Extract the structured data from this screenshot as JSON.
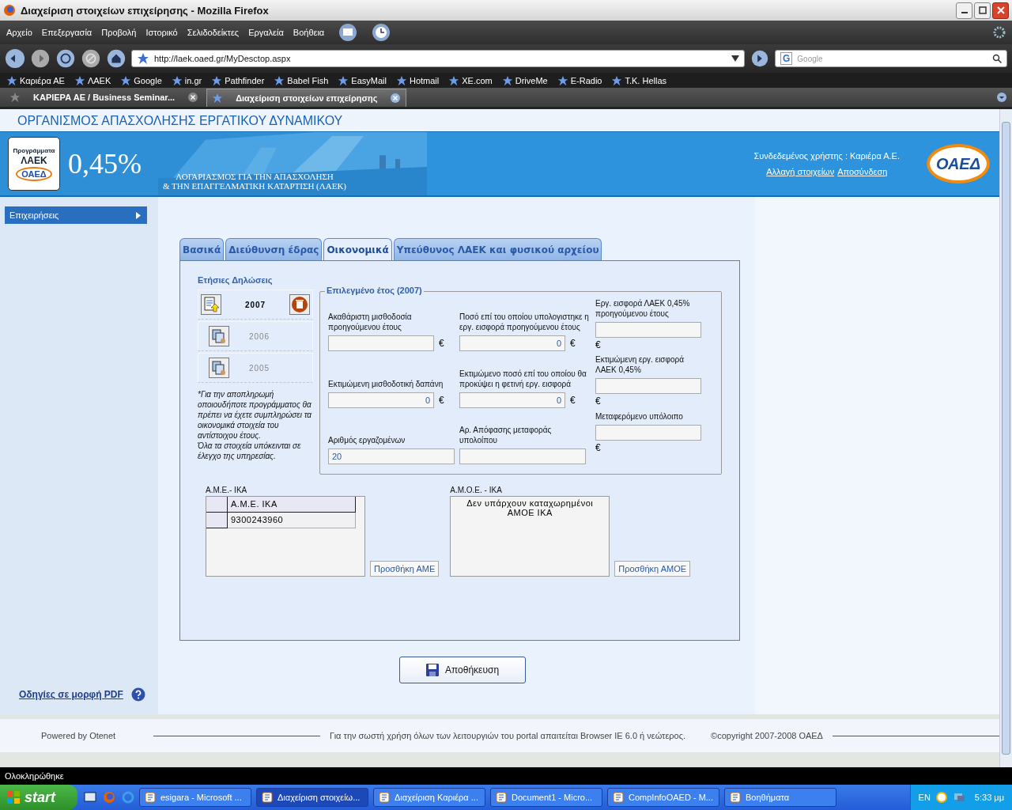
{
  "window": {
    "title": "Διαχείριση στοιχείων επιχείρησης - Mozilla Firefox"
  },
  "menu": [
    "Αρχείο",
    "Επεξεργασία",
    "Προβολή",
    "Ιστορικό",
    "Σελιδοδείκτες",
    "Εργαλεία",
    "Βοήθεια"
  ],
  "address": {
    "value": "http://laek.oaed.gr/MyDesctop.aspx"
  },
  "search": {
    "engine_mark": "G",
    "placeholder": "Google"
  },
  "bookmarks": [
    "Καριέρα ΑΕ",
    "ΛΑΕΚ",
    "Google",
    "in.gr",
    "Pathfinder",
    "Babel Fish",
    "EasyMail",
    "Hotmail",
    "XE.com",
    "DriveMe",
    "E-Radio",
    "T.K. Hellas"
  ],
  "browser_tabs": [
    {
      "label": "ΚΑΡΙΕΡΑ ΑΕ / Business Seminar...",
      "selected": false
    },
    {
      "label": "Διαχείριση στοιχείων επιχείρησης",
      "selected": true
    }
  ],
  "page": {
    "org_title": "ΟΡΓΑΝΙΣΜΟΣ ΑΠΑΣΧΟΛΗΣΗΣ ΕΡΓΑΤΙΚΟΥ ΔΥΝΑΜΙΚΟΥ",
    "banner": {
      "badge_top": "Προγράμματα",
      "badge_name": "ΛΑΕΚ",
      "badge_logo": "ΟΑΕΔ",
      "rate": "0,45%",
      "lines": [
        "ΛΟΓΑΡΙΑΣΜΟΣ ΓΙΑ ΤΗΝ ΑΠΑΣΧΟΛΗΣΗ",
        "& ΤΗΝ ΕΠΑΓΓΕΛΜΑΤΙΚΗ ΚΑΤΑΡΤΙΣΗ (ΛΑΕΚ)"
      ],
      "user": "Συνδεδεμένος χρήστης : Καριέρα Α.Ε.",
      "links": [
        "Αλλαγή στοιχείων",
        "Αποσύνδεση"
      ],
      "logo": "ΟΑΕΔ"
    },
    "sidebar": {
      "items": [
        {
          "label": "Επιχειρήσεις",
          "selected": true
        }
      ],
      "pdf_link": "Οδηγίες σε μορφή PDF"
    },
    "tabs": [
      {
        "label": "Βασικά",
        "selected": false
      },
      {
        "label": "Διεύθυνση έδρας",
        "selected": false
      },
      {
        "label": "Οικονομικά",
        "selected": true
      },
      {
        "label": "Υπεύθυνος ΛΑΕΚ και φυσικού αρχείου",
        "selected": false
      }
    ],
    "declarations": {
      "title": "Ετήσιες Δηλώσεις",
      "years": [
        {
          "year": "2007",
          "selected": true
        },
        {
          "year": "2006",
          "selected": false
        },
        {
          "year": "2005",
          "selected": false
        }
      ],
      "note": [
        "*Για την αποπληρωμή οποιουδήποτε προγράμματος θα πρέπει να έχετε συμπληρώσει τα οικονομικά στοιχεία του αντίστοιχου έτους.",
        "Όλα τα στοιχεία υπόκεινται σε έλεγχο της υπηρεσίας."
      ]
    },
    "fieldset": {
      "legend": "Επιλεγμένο έτος (2007)",
      "columns": [
        {
          "kind": "inline",
          "fields": [
            {
              "label": "Ακαθάριστη μισθοδοσία προηγούμενου έτους",
              "currency": "€"
            },
            {
              "label": "Εκτιμώμενη μισθοδοτική δαπάνη",
              "value": "0",
              "currency": "€"
            },
            {
              "label": "Αριθμός εργαζομένων",
              "value": "20"
            }
          ]
        },
        {
          "kind": "inline",
          "fields": [
            {
              "label": "Ποσό επί του οποίου υπολογιστηκε η εργ. εισφορά προηγούμενου έτους",
              "value": "0",
              "currency": "€"
            },
            {
              "label": "Εκτιμώμενο ποσό επί του οποίου θα προκύψει η φετινή εργ. εισφορά",
              "value": "0",
              "currency": "€"
            },
            {
              "label": "Αρ. Απόφασης μεταφοράς υπολοίπου"
            }
          ]
        },
        {
          "kind": "below",
          "fields": [
            {
              "label": "Εργ. εισφορά ΛΑΕΚ 0,45% προηγούμενου έτους",
              "currency": "€"
            },
            {
              "label": "Εκτιμώμενη εργ. εισφορά ΛΑΕΚ 0,45%",
              "currency": "€"
            },
            {
              "label": "Μεταφερόμενο υπόλοιπο",
              "currency": "€"
            }
          ]
        }
      ]
    },
    "ame": {
      "title": "Α.Μ.Ε.- ΙΚΑ",
      "header": "Α.Μ.Ε. ΙΚΑ",
      "rows": [
        "9300243960"
      ],
      "button": "Προσθήκη ΑΜΕ"
    },
    "amoe": {
      "title": "Α.Μ.Ο.Ε. - ΙΚΑ",
      "empty": "Δεν υπάρχουν καταχωρημένοι ΑΜΟΕ ΙΚΑ",
      "button": "Προσθήκη ΑΜΟΕ"
    },
    "save": "Αποθήκευση",
    "footer": {
      "powered": "Powered by Otenet",
      "notice": "Για την σωστή χρήση όλων των λειτουργιών του portal απαιτείται Browser IE 6.0 ή νεώτερος.",
      "copyright": "©copyright 2007-2008 ΟΑΕΔ"
    }
  },
  "status_bar": "Ολοκληρώθηκε",
  "taskbar": {
    "start": "start",
    "windows": [
      {
        "label": "esigara - Microsoft ...",
        "selected": false
      },
      {
        "label": "Διαχείριση στοιχείω...",
        "selected": true
      },
      {
        "label": "Διαχείριση Καριέρα ...",
        "selected": false
      },
      {
        "label": "Document1 - Micro...",
        "selected": false
      },
      {
        "label": "CompInfoOAED - M...",
        "selected": false
      },
      {
        "label": "Βοηθήματα",
        "selected": false
      }
    ],
    "language": "EN",
    "clock": "5:33 μμ"
  }
}
